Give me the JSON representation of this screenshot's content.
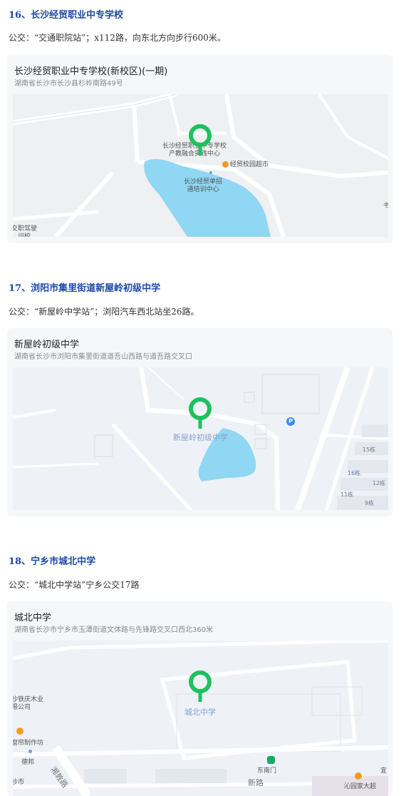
{
  "sections": [
    {
      "title": "16、长沙经贸职业中专学校",
      "transit": "公交：“交通职院站”；x112路，向东北方向步行600米。",
      "card": {
        "name": "长沙经贸职业中专学校(新校区)(一期)",
        "address": "湖南省长沙市长沙县杉岭南路49号"
      },
      "map_labels": {
        "poi1_line1": "长沙经贸职业中专学校",
        "poi1_line2": "产教融合实践中心",
        "poi2": "经贸校园超市",
        "poi3_line1": "长沙经贸单招",
        "poi3_line2": "通培训中心",
        "edge_left_1": "交职驾驶",
        "edge_left_2": "训校",
        "edge_right": "书"
      }
    },
    {
      "title": "17、浏阳市集里街道新屋岭初级中学",
      "transit": "公交：“新屋岭中学站”；浏阳汽车西北站坐26路。",
      "card": {
        "name": "新屋岭初级中学",
        "address": "湖南省长沙市浏阳市集里街道道吾山西路与道吾路交叉口"
      },
      "map_labels": {
        "poi_main": "新屋岭初级中学",
        "parking": "P",
        "b1": "15栋",
        "b2": "16栋",
        "b3": "12栋",
        "b4": "11栋",
        "b5": "9栋"
      }
    },
    {
      "title": "18、宁乡市城北中学",
      "transit": "公交：“城北中学站”宁乡公交17路",
      "card": {
        "name": "城北中学",
        "address": "湖南省长沙市宁乡市玉潭街道文体路与先锋路交叉口西北360米"
      },
      "map_labels": {
        "poi_main": "城北中学",
        "left1_line1": "沙铁庆木业",
        "left1_line2": "限公司",
        "left2": "窗帘制作坊",
        "left3": "德邦",
        "road": "湘敦路",
        "gate": "东南门",
        "bottom_left": "沙市",
        "bottom_road": "新路",
        "bottom_right": "宜",
        "bottom_poi": "沁园家大超"
      }
    }
  ],
  "colors": {
    "title": "#1f4aa8",
    "pin": "#1fc15e",
    "water": "#8fd7f2",
    "map_bg": "#eef1f5",
    "poi_orange": "#f59a23",
    "parking_blue": "#3d8bf2",
    "gate_green": "#1aa76a"
  }
}
